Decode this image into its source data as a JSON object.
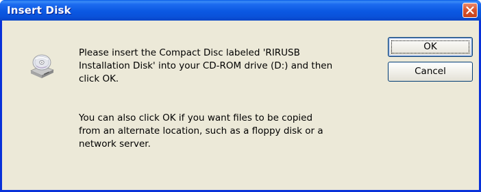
{
  "window": {
    "title": "Insert Disk"
  },
  "icons": {
    "disc_drive": "cd-drive-icon",
    "close": "close-icon"
  },
  "message": {
    "line1": "Please insert the Compact Disc labeled 'RIRUSB\nInstallation Disk' into your CD-ROM drive (D:) and then\nclick OK.",
    "line2": "You can also click OK if you want files to be copied\nfrom an alternate location, such as a floppy disk or a\nnetwork server."
  },
  "buttons": {
    "ok_label": "OK",
    "cancel_label": "Cancel"
  },
  "colors": {
    "titlebar": "#0b58e2",
    "close_button": "#d8552f",
    "client_background": "#ece9d8"
  }
}
